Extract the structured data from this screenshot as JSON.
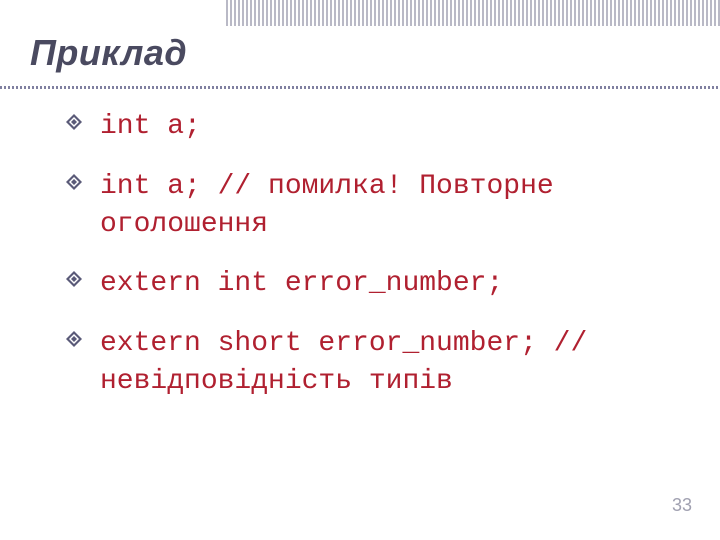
{
  "title": "Приклад",
  "bullets": [
    "int a;",
    "int a; //  помилка! Повторне оголошення",
    "extern   int   error_number;",
    "extern  short  error_number; // невідповідність типів"
  ],
  "page_number": "33"
}
